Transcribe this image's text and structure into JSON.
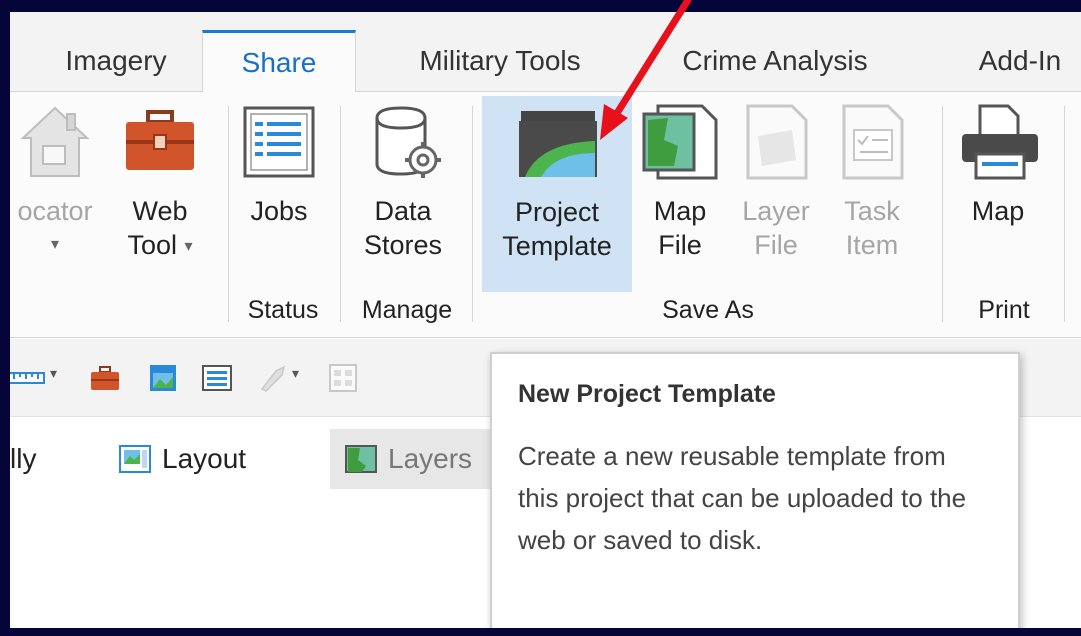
{
  "tabs": [
    {
      "label": "Imagery"
    },
    {
      "label": "Share"
    },
    {
      "label": "Military Tools"
    },
    {
      "label": "Crime Analysis"
    },
    {
      "label": "Add-In"
    }
  ],
  "active_tab": "Share",
  "ribbon": {
    "locator": {
      "label": "ocator",
      "caret": "▾"
    },
    "web_tool": {
      "label_line1": "Web",
      "label_line2": "Tool",
      "caret": "▾"
    },
    "jobs": {
      "label": "Jobs"
    },
    "data_stores": {
      "label_line1": "Data",
      "label_line2": "Stores"
    },
    "project_template": {
      "label_line1": "Project",
      "label_line2": "Template"
    },
    "map_file": {
      "label_line1": "Map",
      "label_line2": "File"
    },
    "layer_file": {
      "label_line1": "Layer",
      "label_line2": "File"
    },
    "task_item": {
      "label_line1": "Task",
      "label_line2": "Item"
    },
    "print_map": {
      "label": "Map"
    },
    "groups": {
      "status": "Status",
      "manage": "Manage",
      "save_as": "Save As",
      "print": "Print"
    }
  },
  "view_tabs": [
    {
      "label": "lly"
    },
    {
      "label": "Layout"
    },
    {
      "label": "Layers"
    }
  ],
  "tooltip": {
    "title": "New Project Template",
    "description": "Create a new reusable template from this project that can be uploaded to the web or saved to disk."
  },
  "colors": {
    "accent": "#1a7bd0",
    "highlight": "#cfe3f5",
    "arrow": "#e8101a",
    "border": "#05053a"
  }
}
